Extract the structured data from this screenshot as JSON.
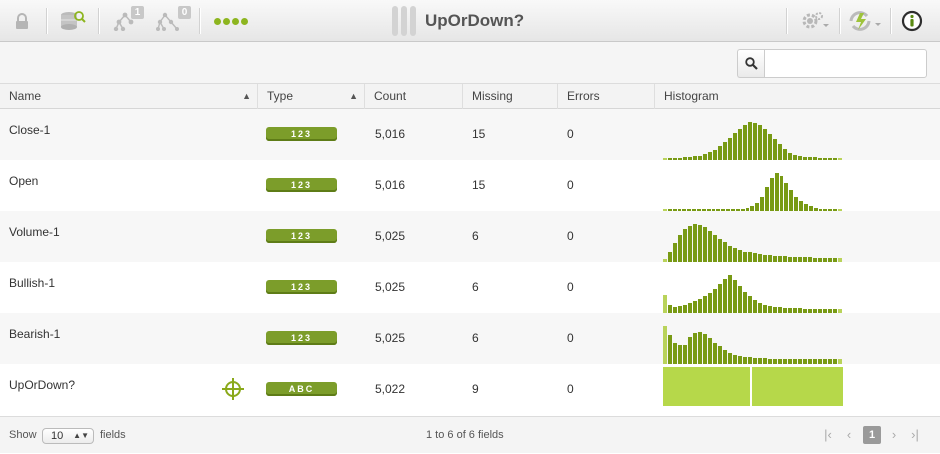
{
  "toolbar": {
    "title": "UpOrDown?",
    "model_badge": "1",
    "ensemble_badge": "0",
    "icons": [
      "lock-icon",
      "dataset-search-icon",
      "model-icon",
      "ensemble-icon",
      "status-dots-icon",
      "settings-gear-icon",
      "actions-icon",
      "info-icon"
    ]
  },
  "search": {
    "value": "",
    "placeholder": ""
  },
  "table": {
    "columns": [
      "Name",
      "Type",
      "Count",
      "Missing",
      "Errors",
      "Histogram"
    ],
    "rows": [
      {
        "name": "Close-1",
        "type": "123",
        "count": "5,016",
        "missing": "15",
        "errors": "0",
        "histogram": [
          3,
          3,
          3,
          3,
          4,
          4,
          5,
          6,
          8,
          11,
          14,
          19,
          24,
          30,
          36,
          42,
          47,
          51,
          50,
          47,
          42,
          35,
          28,
          21,
          15,
          10,
          7,
          5,
          4,
          4,
          4,
          3,
          3,
          3,
          3,
          3
        ]
      },
      {
        "name": "Open",
        "type": "123",
        "count": "5,016",
        "missing": "15",
        "errors": "0",
        "histogram": [
          2,
          2,
          2,
          2,
          2,
          2,
          2,
          2,
          2,
          2,
          2,
          2,
          2,
          2,
          2,
          3,
          3,
          4,
          6,
          11,
          19,
          31,
          44,
          50,
          46,
          37,
          27,
          19,
          13,
          9,
          6,
          4,
          3,
          2,
          2,
          2,
          2
        ]
      },
      {
        "name": "Volume-1",
        "type": "123",
        "count": "5,025",
        "missing": "6",
        "errors": "0",
        "histogram": [
          4,
          12,
          22,
          31,
          38,
          42,
          44,
          43,
          40,
          36,
          31,
          27,
          23,
          19,
          16,
          14,
          12,
          11,
          10,
          9,
          8,
          8,
          7,
          7,
          7,
          6,
          6,
          6,
          6,
          6,
          5,
          5,
          5,
          5,
          5,
          5
        ]
      },
      {
        "name": "Bullish-1",
        "type": "123",
        "count": "5,025",
        "missing": "6",
        "errors": "0",
        "histogram": [
          18,
          8,
          6,
          7,
          8,
          10,
          12,
          14,
          17,
          21,
          25,
          30,
          35,
          39,
          34,
          28,
          22,
          17,
          13,
          10,
          8,
          7,
          6,
          6,
          5,
          5,
          5,
          5,
          4,
          4,
          4,
          4,
          4,
          4,
          4,
          4
        ]
      },
      {
        "name": "Bearish-1",
        "type": "123",
        "count": "5,025",
        "missing": "6",
        "errors": "0",
        "histogram": [
          39,
          30,
          22,
          19,
          20,
          28,
          32,
          33,
          31,
          27,
          22,
          18,
          14,
          11,
          9,
          8,
          7,
          7,
          6,
          6,
          6,
          5,
          5,
          5,
          5,
          5,
          5,
          5,
          5,
          5,
          5,
          5,
          5,
          5,
          5,
          5
        ]
      },
      {
        "name": "UpOrDown?",
        "type": "ABC",
        "count": "5,022",
        "missing": "9",
        "errors": "0",
        "histogram_categories": [
          49.5,
          50.5
        ]
      }
    ]
  },
  "footer": {
    "show_label": "Show",
    "page_size": "10",
    "fields_label": "fields",
    "range_text": "1 to 6 of 6 fields",
    "current_page": "1"
  },
  "colors": {
    "accent": "#8db51f",
    "type_badge": "#7c9d2a",
    "histogram_bar": "#789a14",
    "categorical_bar": "#b6d84a"
  }
}
